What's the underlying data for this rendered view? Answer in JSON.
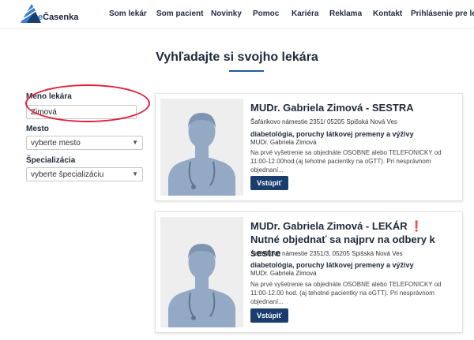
{
  "brand": {
    "name_prefix": "e",
    "name_main": "Časenka"
  },
  "nav": {
    "items": [
      {
        "label": "Som lekár"
      },
      {
        "label": "Som pacient"
      },
      {
        "label": "Novinky"
      },
      {
        "label": "Pomoc"
      },
      {
        "label": "Kariéra"
      },
      {
        "label": "Reklama"
      },
      {
        "label": "Kontakt"
      },
      {
        "label": "Prihlásenie pre lekárov"
      }
    ]
  },
  "page": {
    "title": "Vyhľadajte si svojho lekára"
  },
  "filters": {
    "name_label": "Meno lekára",
    "name_value": "Zimová",
    "city_label": "Mesto",
    "city_value": "vyberte mesto",
    "spec_label": "Špecializácia",
    "spec_value": "vyberte špecializáciu"
  },
  "results": [
    {
      "name": "MUDr. Gabriela Zimová - SESTRA",
      "address": "Šafárikovo námestie 2351/ 05205 Spišská Nová Ves",
      "specialization": "diabetológia, poruchy látkovej premeny a výživy",
      "doctor": "MUDr. Gabriela Zimová",
      "note": "Na prvé vyšetrenie sa objednáte OSOBNE alebo TELEFONICKY od 11:00-12.00hod (aj tehotné pacientky na oGTT). Pri nesprávnom objednaní...",
      "button": "Vstúpiť"
    },
    {
      "name_main": "MUDr. Gabriela Zimová - LEKÁR",
      "name_urgent_mark": "❗",
      "name_urgent": "Nutné objednať sa najprv na odbery k sestre",
      "address": "Šafárikovo námestie 2351/3, 05205 Spišská Nová Ves",
      "specialization": "diabetológia, poruchy látkovej premeny a výživy",
      "doctor": "MUDr. Gabriela Zimová",
      "note": "Na prvé vyšetrenie sa objednáte OSOBNE alebo TELEFONICKY od 11:00-12.00 hod. (aj tehotné pacientky na oGTT). Pri nesprávnom objednaní...",
      "button": "Vstúpiť"
    }
  ],
  "colors": {
    "accent": "#1b3d6e",
    "underline": "#1e5aa0",
    "highlight": "#e2203a",
    "placeholder_bg": "#eeeeee",
    "avatar": "#93a9c4"
  }
}
